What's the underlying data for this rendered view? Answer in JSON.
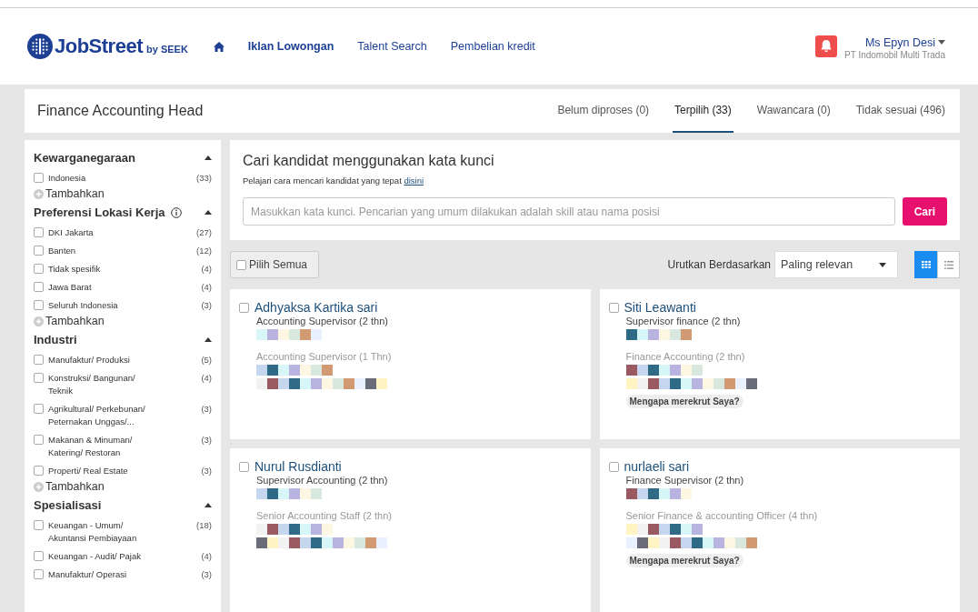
{
  "header": {
    "logo": "JobStreet",
    "logo_suffix": "by SEEK",
    "nav": [
      {
        "label": "Iklan Lowongan",
        "selected": true
      },
      {
        "label": "Talent Search",
        "selected": false
      },
      {
        "label": "Pembelian kredit",
        "selected": false
      }
    ],
    "user": {
      "name": "Ms Epyn Desi",
      "company": "PT Indomobil Multi Trada"
    }
  },
  "job": {
    "title": "Finance Accounting Head",
    "tabs": [
      {
        "label": "Belum diproses (0)",
        "selected": false
      },
      {
        "label": "Terpilih (33)",
        "selected": true
      },
      {
        "label": "Wawancara (0)",
        "selected": false
      },
      {
        "label": "Tidak sesuai (496)",
        "selected": false
      }
    ]
  },
  "filters": [
    {
      "title": "Kewarganegaraan",
      "info": false,
      "items": [
        {
          "label": "Indonesia",
          "count": "(33)",
          "checked": false
        }
      ],
      "add": "Tambahkan"
    },
    {
      "title": "Preferensi Lokasi Kerja",
      "info": true,
      "items": [
        {
          "label": "DKI Jakarta",
          "count": "(27)",
          "checked": false
        },
        {
          "label": "Banten",
          "count": "(12)",
          "checked": false
        },
        {
          "label": "Tidak spesifik",
          "count": "(4)",
          "checked": false
        },
        {
          "label": "Jawa Barat",
          "count": "(4)",
          "checked": false
        },
        {
          "label": "Seluruh Indonesia",
          "count": "(3)",
          "checked": false
        }
      ],
      "add": "Tambahkan"
    },
    {
      "title": "Industri",
      "info": false,
      "items": [
        {
          "label": "Manufaktur/ Produksi",
          "count": "(5)",
          "checked": false
        },
        {
          "label": "Konstruksi/ Bangunan/ Teknik",
          "count": "(4)",
          "checked": false
        },
        {
          "label": "Agrikultural/ Perkebunan/ Peternakan Unggas/...",
          "count": "(3)",
          "checked": false
        },
        {
          "label": "Makanan & Minuman/ Katering/ Restoran",
          "count": "(3)",
          "checked": false
        },
        {
          "label": "Properti/ Real Estate",
          "count": "(3)",
          "checked": false
        }
      ],
      "add": "Tambahkan"
    },
    {
      "title": "Spesialisasi",
      "info": false,
      "items": [
        {
          "label": "Keuangan - Umum/ Akuntansi Pembiayaan",
          "count": "(18)",
          "checked": false
        },
        {
          "label": "Keuangan - Audit/ Pajak",
          "count": "(4)",
          "checked": false
        },
        {
          "label": "Manufaktur/ Operasi",
          "count": "(3)",
          "checked": false
        }
      ]
    }
  ],
  "search": {
    "title": "Cari kandidat menggunakan kata kunci",
    "hint": "Pelajari cara mencari kandidat yang tepat",
    "hint_link": "disini",
    "placeholder": "Masukkan kata kunci. Pencarian yang umum dilakukan adalah skill atau nama posisi",
    "button": "Cari"
  },
  "toolbar": {
    "select_all": "Pilih Semua",
    "select_all_checked": false,
    "sort_label": "Urutkan Berdasarkan",
    "sort_value": "Paling relevan",
    "views": [
      {
        "kind": "grid",
        "selected": true
      },
      {
        "kind": "list",
        "selected": false
      }
    ]
  },
  "candidates": [
    {
      "name": "Adhyaksa Kartika sari",
      "checked": false,
      "current": "Accounting Supervisor",
      "current_years": "(2 thn)",
      "past": "Accounting Supervisor",
      "past_years": "(1 Thn)"
    },
    {
      "name": "Siti Leawanti",
      "checked": false,
      "current": "Supervisor finance",
      "current_years": "(2 thn)",
      "past": "Finance Accounting",
      "past_years": "(2 thn)",
      "badge": "Mengapa merekrut Saya?"
    },
    {
      "name": "Nurul Rusdianti",
      "checked": false,
      "current": "Supervisor Accounting",
      "current_years": "(2 thn)",
      "past": "Senior Accounting Staff",
      "past_years": "(2 thn)"
    },
    {
      "name": "nurlaeli sari",
      "checked": false,
      "current": "Finance Supervisor",
      "current_years": "(2 thn)",
      "past": "Senior Finance & accounting Officer",
      "past_years": "(4 thn)",
      "badge": "Mengapa merekrut Saya?"
    }
  ]
}
